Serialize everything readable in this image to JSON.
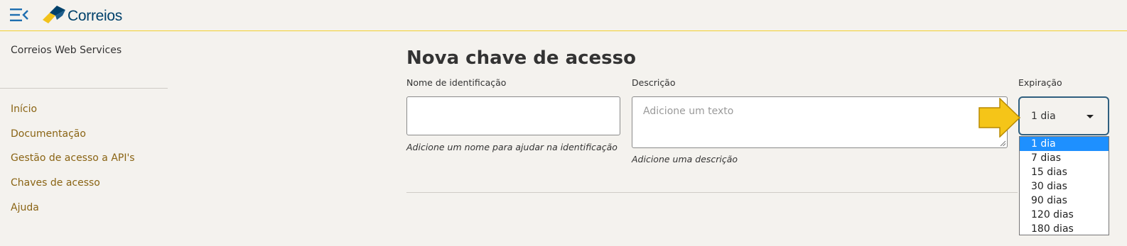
{
  "header": {
    "brand": "Correios",
    "colors": {
      "accent_line": "#f2cf2f",
      "brand_blue": "#00416b",
      "logo_yellow": "#f2c21b"
    }
  },
  "sidebar": {
    "title": "Correios Web Services",
    "items": [
      {
        "label": "Início"
      },
      {
        "label": "Documentação"
      },
      {
        "label": "Gestão de acesso a API's"
      },
      {
        "label": "Chaves de acesso"
      },
      {
        "label": "Ajuda"
      }
    ]
  },
  "form": {
    "title": "Nova chave de acesso",
    "name_field": {
      "label": "Nome de identificação",
      "value": "",
      "hint": "Adicione um nome para ajudar na identificação"
    },
    "description_field": {
      "label": "Descrição",
      "placeholder": "Adicione um texto",
      "hint": "Adicione uma descrição"
    },
    "expiration": {
      "label": "Expiração",
      "selected": "1 dia",
      "options": [
        "1 dia",
        "7 dias",
        "15 dias",
        "30 dias",
        "90 dias",
        "120 dias",
        "180 dias"
      ],
      "selected_index": 0
    }
  },
  "icons": {
    "menu_toggle": "menu-collapse-icon",
    "logo": "correios-logo-icon",
    "caret": "caret-down-icon",
    "pointer": "arrow-right-icon"
  }
}
